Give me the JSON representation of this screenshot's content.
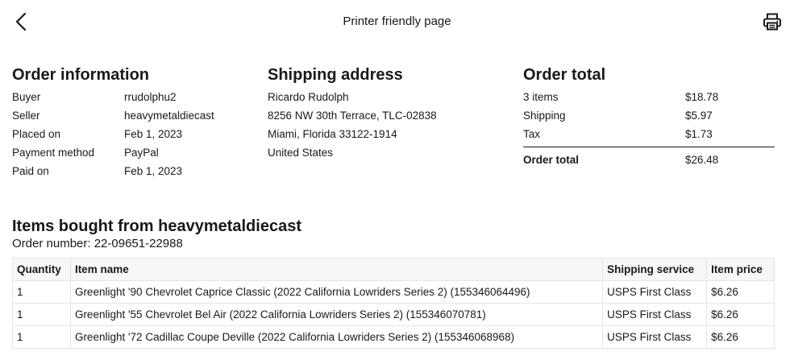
{
  "header": {
    "title": "Printer friendly page",
    "back_icon": "chevron-left-icon",
    "print_icon": "printer-icon"
  },
  "order_information": {
    "title": "Order information",
    "rows": [
      {
        "label": "Buyer",
        "value": "rrudolphu2"
      },
      {
        "label": "Seller",
        "value": "heavymetaldiecast"
      },
      {
        "label": "Placed on",
        "value": "Feb 1, 2023"
      },
      {
        "label": "Payment method",
        "value": "PayPal"
      },
      {
        "label": "Paid on",
        "value": "Feb 1, 2023"
      }
    ]
  },
  "shipping_address": {
    "title": "Shipping address",
    "lines": [
      "Ricardo Rudolph",
      "8256 NW 30th Terrace, TLC-02838",
      "Miami, Florida 33122-1914",
      "United States"
    ]
  },
  "order_total": {
    "title": "Order total",
    "rows": [
      {
        "label": "3 items",
        "value": "$18.78"
      },
      {
        "label": "Shipping",
        "value": "$5.97"
      },
      {
        "label": "Tax",
        "value": "$1.73"
      }
    ],
    "total": {
      "label": "Order total",
      "value": "$26.48"
    }
  },
  "items": {
    "title": "Items bought from heavymetaldiecast",
    "order_number": "Order number: 22-09651-22988",
    "columns": [
      "Quantity",
      "Item name",
      "Shipping service",
      "Item price"
    ],
    "rows": [
      {
        "quantity": "1",
        "name": "Greenlight '90 Chevrolet Caprice Classic (2022 California Lowriders Series 2) (155346064496)",
        "shipping": "USPS First Class",
        "price": "$6.26"
      },
      {
        "quantity": "1",
        "name": "Greenlight '55 Chevrolet Bel Air (2022 California Lowriders Series 2) (155346070781)",
        "shipping": "USPS First Class",
        "price": "$6.26"
      },
      {
        "quantity": "1",
        "name": "Greenlight '72 Cadillac Coupe Deville (2022 California Lowriders Series 2) (155346068968)",
        "shipping": "USPS First Class",
        "price": "$6.26"
      }
    ]
  }
}
